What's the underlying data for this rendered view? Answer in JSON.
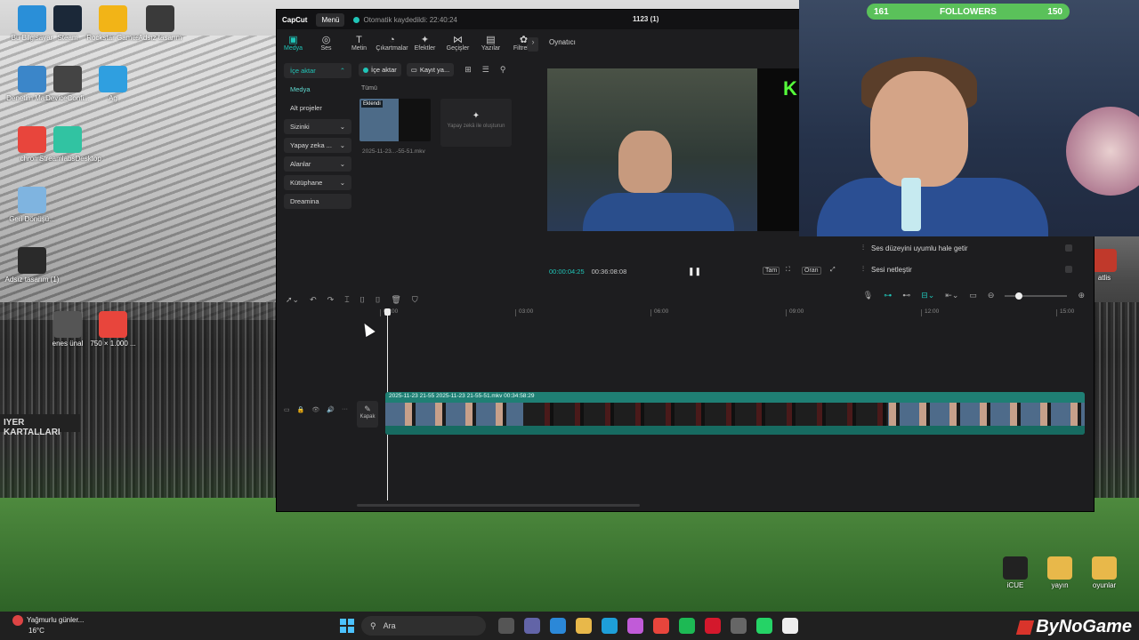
{
  "desktop": {
    "banner_text": "IYER KARTALLARI",
    "icons": [
      {
        "label": "Bu Bilgisayar",
        "icon": "computer-icon",
        "color": "#2a8fd8"
      },
      {
        "label": "Steam",
        "icon": "steam-icon",
        "color": "#1b2838"
      },
      {
        "label": "Rockstar Games",
        "icon": "rockstar-icon",
        "color": "#f2b417"
      },
      {
        "label": "Adsız tasarım",
        "icon": "image-icon",
        "color": "#3a3a3a"
      },
      {
        "label": "Denetim Masası",
        "icon": "control-panel-icon",
        "color": "#3b86c9"
      },
      {
        "label": "DeviceConfi...",
        "icon": "device-icon",
        "color": "#444"
      },
      {
        "label": "Ag",
        "icon": "network-icon",
        "color": "#2f9fe0"
      },
      {
        "label": "chrome",
        "icon": "chrome-icon",
        "color": "#e8453c"
      },
      {
        "label": "StreamlabsDesktop",
        "icon": "streamlabs-icon",
        "color": "#31c3a2"
      },
      {
        "label": "Geri Dönüşü...",
        "icon": "recycle-bin-icon",
        "color": "#7fb4e0"
      },
      {
        "label": "Adsız tasarım (1)",
        "icon": "image-icon",
        "color": "#2a2a2a"
      },
      {
        "label": "enes ünal",
        "icon": "media-icon",
        "color": "#555"
      },
      {
        "label": "750 × 1.000 ...",
        "icon": "chrome-icon",
        "color": "#e8453c"
      }
    ],
    "right_icons": [
      {
        "label": "iCUE",
        "icon": "icue-icon",
        "color": "#222"
      },
      {
        "label": "yayın",
        "icon": "folder-icon",
        "color": "#e8b84a"
      },
      {
        "label": "oyunlar",
        "icon": "folder-icon",
        "color": "#e8b84a"
      },
      {
        "label": "atlis",
        "icon": "app-icon",
        "color": "#c0392b"
      }
    ]
  },
  "capcut": {
    "logo": "CapCut",
    "menu_label": "Menü",
    "autosave": "Otomatik kaydedildi: 22:40:24",
    "project_title": "1123 (1)",
    "tools": [
      {
        "label": "Medya",
        "glyph": "▣",
        "active": true
      },
      {
        "label": "Ses",
        "glyph": "◎",
        "active": false
      },
      {
        "label": "Metin",
        "glyph": "T",
        "active": false
      },
      {
        "label": "Çıkartmalar",
        "glyph": "◔",
        "active": false
      },
      {
        "label": "Efektler",
        "glyph": "✦",
        "active": false
      },
      {
        "label": "Geçişler",
        "glyph": "⋈",
        "active": false
      },
      {
        "label": "Yazılar",
        "glyph": "▤",
        "active": false
      },
      {
        "label": "Filtreler",
        "glyph": "✿",
        "active": false
      }
    ],
    "sidebar": [
      {
        "label": "İçe aktar",
        "caret": "⌃",
        "style": "boxed active"
      },
      {
        "label": "Medya",
        "caret": "",
        "style": "current"
      },
      {
        "label": "Alt projeler",
        "caret": "",
        "style": ""
      },
      {
        "label": "Sizinki",
        "caret": "⌄",
        "style": "boxed"
      },
      {
        "label": "Yapay zeka ...",
        "caret": "⌄",
        "style": "boxed"
      },
      {
        "label": "Alanlar",
        "caret": "⌄",
        "style": "boxed"
      },
      {
        "label": "Kütüphane",
        "caret": "⌄",
        "style": "boxed"
      },
      {
        "label": "Dreamina",
        "caret": "",
        "style": "boxed"
      }
    ],
    "media": {
      "import_label": "İçe aktar",
      "record_label": "Kayıt ya...",
      "all_label": "Tümü",
      "clip_tag": "Eklendi",
      "clip_name": "2025-11-23...-55-51.mkv",
      "ai_card_label": "Yapay zekâ ile oluşturun"
    },
    "player": {
      "title": "Oynatıcı",
      "current_time": "00:00:04:25",
      "total_time": "00:36:08:08",
      "btn_full": "Tam",
      "btn_ratio": "Oran"
    },
    "audio_panel": [
      {
        "label": "Ses düzeyini uyumlu hale getir"
      },
      {
        "label": "Sesi netleştir"
      }
    ],
    "timeline": {
      "ruler": [
        "00:00",
        "03:00",
        "06:00",
        "09:00",
        "12:00",
        "15:00"
      ],
      "cover_label": "Kapak",
      "clip_label": "2025-11-23 21-55   2025-11-23 21-55-51.mkv   00:34:58:29"
    }
  },
  "webcam": {
    "followers_label": "FOLLOWERS",
    "followers_current": "161",
    "followers_goal": "150"
  },
  "taskbar": {
    "weather_title": "Yağmurlu günler...",
    "weather_temp": "16°C",
    "search_label": "Ara",
    "brand": "ByNoGame",
    "apps": [
      {
        "icon": "task-view-icon",
        "color": "#555"
      },
      {
        "icon": "teams-icon",
        "color": "#6264a7"
      },
      {
        "icon": "store-icon",
        "color": "#2b88d8"
      },
      {
        "icon": "file-explorer-icon",
        "color": "#e8b84a"
      },
      {
        "icon": "edge-icon",
        "color": "#1e9fd8"
      },
      {
        "icon": "copilot-icon",
        "color": "#c15bd8"
      },
      {
        "icon": "chrome-icon",
        "color": "#e8453c"
      },
      {
        "icon": "spotify-icon",
        "color": "#1db954"
      },
      {
        "icon": "opera-icon",
        "color": "#d4182c"
      },
      {
        "icon": "app-icon",
        "color": "#666"
      },
      {
        "icon": "whatsapp-icon",
        "color": "#25d366"
      },
      {
        "icon": "capcut-icon",
        "color": "#eee"
      }
    ]
  }
}
